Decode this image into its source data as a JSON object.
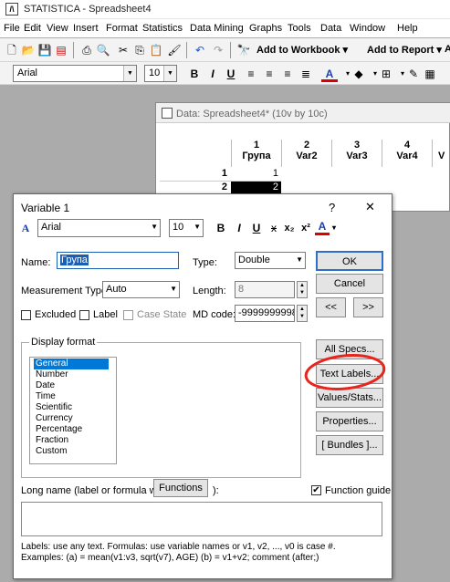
{
  "window": {
    "title": "STATISTICA - Spreadsheet4"
  },
  "menu": [
    "File",
    "Edit",
    "View",
    "Insert",
    "Format",
    "Statistics",
    "Data Mining",
    "Graphs",
    "Tools",
    "Data",
    "Window",
    "Help"
  ],
  "toolbar1": {
    "add_workbook": "Add to Workbook ▾",
    "add_report": "Add to Report ▾",
    "more": "A"
  },
  "toolbar2": {
    "font": "Arial",
    "size": "10"
  },
  "sheet": {
    "title": "Data: Spreadsheet4* (10v by 10c)",
    "columns": [
      {
        "num": "1",
        "name": "Група"
      },
      {
        "num": "2",
        "name": "Var2"
      },
      {
        "num": "3",
        "name": "Var3"
      },
      {
        "num": "4",
        "name": "Var4"
      },
      {
        "num": "",
        "name": "V"
      }
    ],
    "rows": [
      {
        "num": "1",
        "value": "1"
      },
      {
        "num": "2",
        "value": "2"
      }
    ]
  },
  "dialog": {
    "title": "Variable 1",
    "help": "?",
    "close": "✕",
    "font": "Arial",
    "size": "10",
    "name_label": "Name:",
    "name_value": "Група",
    "type_label": "Type:",
    "type_value": "Double",
    "ok": "OK",
    "cancel": "Cancel",
    "prev": "<<",
    "next": ">>",
    "mtype_label": "Measurement Type:",
    "mtype_value": "Auto",
    "length_label": "Length:",
    "length_value": "8",
    "excluded": "Excluded",
    "label": "Label",
    "case_state": "Case State",
    "md_label": "MD code:",
    "md_value": "-9999999998",
    "display_format": "Display format",
    "formats": [
      "General",
      "Number",
      "Date",
      "Time",
      "Scientific",
      "Currency",
      "Percentage",
      "Fraction",
      "Custom"
    ],
    "all_specs": "All Specs...",
    "text_labels": "Text Labels...",
    "values_stats": "Values/Stats...",
    "properties": "Properties...",
    "bundles": "[ Bundles ]...",
    "long_name": "Long name (label or formula with",
    "functions": "Functions",
    "long_name_end": "):",
    "function_guide": "Function guide",
    "help1": "Labels: use any text.  Formulas: use variable names or v1, v2, ..., v0 is case #.",
    "help2": "Examples:   (a) = mean(v1:v3, sqrt(v7), AGE)   (b) = v1+v2; comment (after;)"
  },
  "colors": {
    "selection": "#0078d7",
    "annotation": "#e8241c",
    "dialog_bg": "#ffffff"
  }
}
